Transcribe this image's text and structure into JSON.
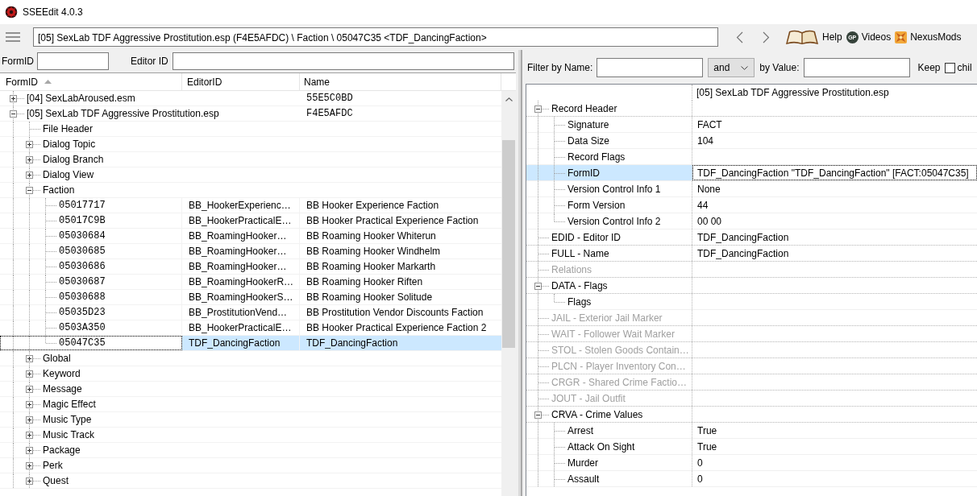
{
  "window": {
    "title": "SSEEdit 4.0.3"
  },
  "toolbar": {
    "path": "[05] SexLab TDF Aggressive Prostitution.esp (F4E5AFDC) \\ Faction \\ 05047C35 <TDF_DancingFaction>",
    "links": [
      {
        "kind": "book",
        "label": "Help"
      },
      {
        "kind": "badge",
        "badge": "GP",
        "label": "Videos"
      },
      {
        "kind": "tile",
        "label": "NexusMods"
      }
    ]
  },
  "search": {
    "fields": [
      {
        "label": "FormID"
      },
      {
        "label": "Editor ID"
      }
    ]
  },
  "navigator": {
    "columns": [
      {
        "label": "FormID",
        "sorted": true
      },
      {
        "label": "EditorID",
        "sorted": false
      },
      {
        "label": "Name",
        "sorted": false
      }
    ],
    "rows": [
      {
        "kind": "file",
        "label": "[04] SexLabAroused.esm",
        "name": "55E5C0BD",
        "expanded": false,
        "selected": false
      },
      {
        "kind": "file",
        "label": "[05] SexLab TDF Aggressive Prostitution.esp",
        "name": "F4E5AFDC",
        "expanded": true,
        "selected": false,
        "children": [
          {
            "kind": "leaf",
            "label": "File Header",
            "selected": false
          },
          {
            "kind": "group",
            "label": "Dialog Topic",
            "expanded": false,
            "selected": false
          },
          {
            "kind": "group",
            "label": "Dialog Branch",
            "expanded": false,
            "selected": false
          },
          {
            "kind": "group",
            "label": "Dialog View",
            "expanded": false,
            "selected": false
          },
          {
            "kind": "group",
            "label": "Faction",
            "expanded": true,
            "selected": false,
            "children": [
              {
                "kind": "record",
                "label": "05017717",
                "editor_id": "BB_HookerExperienc…",
                "name": "BB Hooker Experience Faction",
                "selected": false
              },
              {
                "kind": "record",
                "label": "05017C9B",
                "editor_id": "BB_HookerPracticalE…",
                "name": "BB Hooker Practical Experience Faction",
                "selected": false
              },
              {
                "kind": "record",
                "label": "05030684",
                "editor_id": "BB_RoamingHooker…",
                "name": "BB Roaming Hooker Whiterun",
                "selected": false
              },
              {
                "kind": "record",
                "label": "05030685",
                "editor_id": "BB_RoamingHooker…",
                "name": "BB Roaming Hooker Windhelm",
                "selected": false
              },
              {
                "kind": "record",
                "label": "05030686",
                "editor_id": "BB_RoamingHooker…",
                "name": "BB Roaming Hooker Markarth",
                "selected": false
              },
              {
                "kind": "record",
                "label": "05030687",
                "editor_id": "BB_RoamingHookerR…",
                "name": "BB Roaming Hooker Riften",
                "selected": false
              },
              {
                "kind": "record",
                "label": "05030688",
                "editor_id": "BB_RoamingHookerS…",
                "name": "BB Roaming Hooker Solitude",
                "selected": false
              },
              {
                "kind": "record",
                "label": "05035D23",
                "editor_id": "BB_ProstitutionVend…",
                "name": "BB Prostitution Vendor Discounts Faction",
                "selected": false
              },
              {
                "kind": "record",
                "label": "0503A350",
                "editor_id": "BB_HookerPracticalE…",
                "name": "BB Hooker Practical Experience Faction 2",
                "selected": false
              },
              {
                "kind": "record",
                "label": "05047C35",
                "editor_id": "TDF_DancingFaction",
                "name": "TDF_DancingFaction",
                "selected": true
              }
            ]
          },
          {
            "kind": "group",
            "label": "Global",
            "expanded": false,
            "selected": false
          },
          {
            "kind": "group",
            "label": "Keyword",
            "expanded": false,
            "selected": false
          },
          {
            "kind": "group",
            "label": "Message",
            "expanded": false,
            "selected": false
          },
          {
            "kind": "group",
            "label": "Magic Effect",
            "expanded": false,
            "selected": false
          },
          {
            "kind": "group",
            "label": "Music Type",
            "expanded": false,
            "selected": false
          },
          {
            "kind": "group",
            "label": "Music Track",
            "expanded": false,
            "selected": false
          },
          {
            "kind": "group",
            "label": "Package",
            "expanded": false,
            "selected": false
          },
          {
            "kind": "group",
            "label": "Perk",
            "expanded": false,
            "selected": false
          },
          {
            "kind": "group",
            "label": "Quest",
            "expanded": false,
            "selected": false
          }
        ]
      }
    ]
  },
  "record_view": {
    "filter": {
      "name_label": "Filter by Name:",
      "operator": "and",
      "value_label": "by Value:",
      "keep_label": "Keep",
      "keep_checked": false,
      "child_label": "chil"
    },
    "file_header": "[05] SexLab TDF Aggressive Prostitution.esp",
    "rows": [
      {
        "kind": "group",
        "label": "Record Header",
        "expanded": true,
        "disabled": false,
        "selected": false,
        "children": [
          {
            "kind": "field",
            "label": "Signature",
            "value": "FACT",
            "disabled": false,
            "selected": false
          },
          {
            "kind": "field",
            "label": "Data Size",
            "value": "104",
            "disabled": false,
            "selected": false
          },
          {
            "kind": "field",
            "label": "Record Flags",
            "disabled": false,
            "selected": false
          },
          {
            "kind": "field",
            "label": "FormID",
            "value": "TDF_DancingFaction \"TDF_DancingFaction\" [FACT:05047C35]",
            "disabled": false,
            "selected": true
          },
          {
            "kind": "field",
            "label": "Version Control Info 1",
            "value": "None",
            "disabled": false,
            "selected": false
          },
          {
            "kind": "field",
            "label": "Form Version",
            "value": "44",
            "disabled": false,
            "selected": false
          },
          {
            "kind": "field",
            "label": "Version Control Info 2",
            "value": "00 00",
            "disabled": false,
            "selected": false
          }
        ]
      },
      {
        "kind": "field",
        "label": "EDID - Editor ID",
        "value": "TDF_DancingFaction",
        "disabled": false,
        "selected": false
      },
      {
        "kind": "field",
        "label": "FULL - Name",
        "value": "TDF_DancingFaction",
        "disabled": false,
        "selected": false
      },
      {
        "kind": "field",
        "label": "Relations",
        "disabled": true,
        "selected": false
      },
      {
        "kind": "group",
        "label": "DATA - Flags",
        "expanded": true,
        "disabled": false,
        "selected": false,
        "children": [
          {
            "kind": "field",
            "label": "Flags",
            "disabled": false,
            "selected": false
          }
        ]
      },
      {
        "kind": "field",
        "label": "JAIL - Exterior Jail Marker",
        "disabled": true,
        "selected": false
      },
      {
        "kind": "field",
        "label": "WAIT - Follower Wait Marker",
        "disabled": true,
        "selected": false
      },
      {
        "kind": "field",
        "label": "STOL - Stolen Goods Contain…",
        "disabled": true,
        "selected": false
      },
      {
        "kind": "field",
        "label": "PLCN - Player Inventory Con…",
        "disabled": true,
        "selected": false
      },
      {
        "kind": "field",
        "label": "CRGR - Shared Crime Factio…",
        "disabled": true,
        "selected": false
      },
      {
        "kind": "field",
        "label": "JOUT - Jail Outfit",
        "disabled": true,
        "selected": false
      },
      {
        "kind": "group",
        "label": "CRVA - Crime Values",
        "expanded": true,
        "disabled": false,
        "selected": false,
        "children": [
          {
            "kind": "field",
            "label": "Arrest",
            "value": "True",
            "disabled": false,
            "selected": false
          },
          {
            "kind": "field",
            "label": "Attack On Sight",
            "value": "True",
            "disabled": false,
            "selected": false
          },
          {
            "kind": "field",
            "label": "Murder",
            "value": "0",
            "disabled": false,
            "selected": false
          },
          {
            "kind": "field",
            "label": "Assault",
            "value": "0",
            "disabled": false,
            "selected": false
          }
        ]
      }
    ]
  }
}
